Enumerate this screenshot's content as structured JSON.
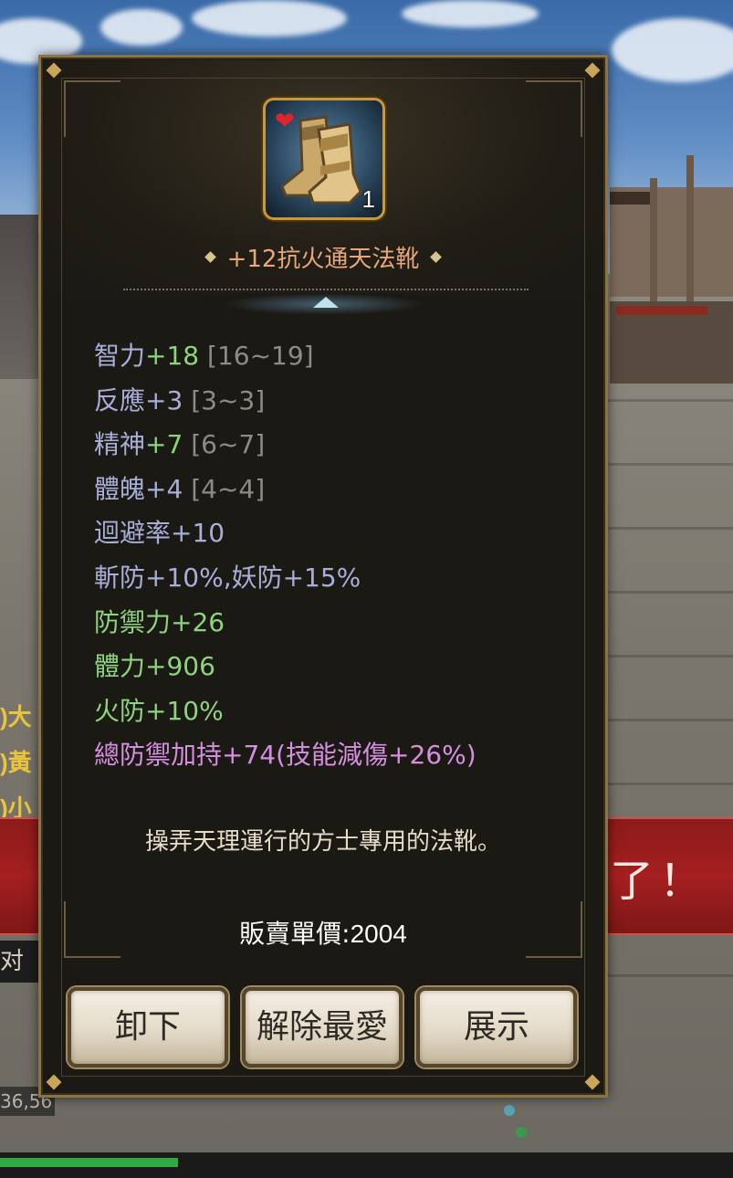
{
  "background": {
    "chat_fragments": [
      ")大",
      ")黃",
      ")小"
    ],
    "banner_text": "了！",
    "dialog_tab": "对話",
    "coords": "36,56"
  },
  "item": {
    "icon": "boots-icon",
    "favorite_icon": "heart-icon",
    "quantity": "1",
    "name": "+12抗火通天法靴"
  },
  "stats": [
    {
      "name": "智力",
      "value": "+18",
      "range": "[16~19]"
    },
    {
      "name": "反應",
      "value": "+3",
      "range": "[3~3]"
    },
    {
      "name": "精神",
      "value": "+7",
      "range": "[6~7]"
    },
    {
      "name": "體魄",
      "value": "+4",
      "range": "[4~4]"
    }
  ],
  "bonus_lines": {
    "evasion": "迴避率+10",
    "resist": "斬防+10%,妖防+15%",
    "defense": "防禦力+26",
    "stamina": "體力+906",
    "fire_resist": "火防+10%",
    "total_defense": "總防禦加持+74(技能減傷+26%)"
  },
  "description": "操弄天理運行的方士專用的法靴。",
  "price": {
    "label": "販賣單價:",
    "value": "2004"
  },
  "buttons": {
    "unequip": "卸下",
    "unfavorite": "解除最愛",
    "show": "展示"
  },
  "colors": {
    "frame_gold": "#8a7446",
    "name_orange": "#e7a77b",
    "stat_lavender": "#a8aed8",
    "stat_green": "#8fd37c",
    "range_gray": "#8b8b8b",
    "set_pink": "#d58fe0"
  }
}
